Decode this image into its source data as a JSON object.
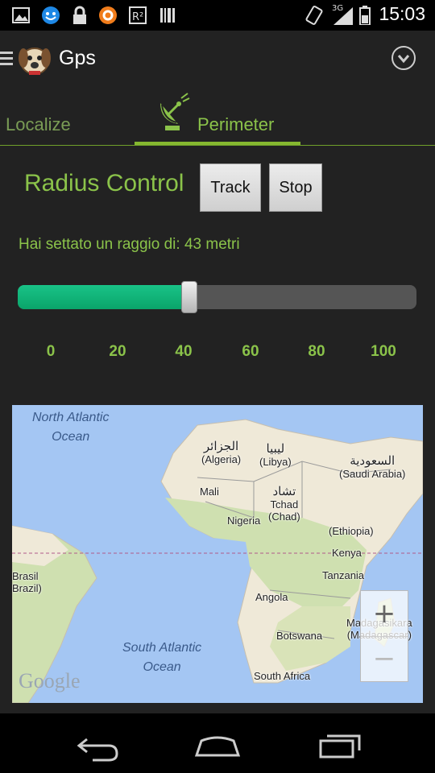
{
  "status_bar": {
    "time": "15:03",
    "network": "3G",
    "left_icons": [
      "image-icon",
      "messenger-icon",
      "lock-icon",
      "avast-icon",
      "r2-icon",
      "barcode-icon"
    ],
    "right_icons": [
      "vibrate-icon",
      "signal-icon",
      "battery-icon"
    ]
  },
  "action_bar": {
    "title": "Gps",
    "icons": [
      "menu-icon",
      "app-logo",
      "overflow-icon"
    ]
  },
  "tabs": [
    {
      "label": "Localize",
      "selected": false
    },
    {
      "label": "Perimeter",
      "selected": true,
      "icon": "satellite-dish-icon"
    }
  ],
  "radius": {
    "title": "Radius Control",
    "track_label": "Track",
    "stop_label": "Stop",
    "info": "Hai settato un raggio di: 43 metri",
    "value": 43,
    "min": 0,
    "max": 100,
    "ticks": [
      "0",
      "20",
      "40",
      "60",
      "80",
      "100"
    ]
  },
  "map": {
    "labels": {
      "north_atlantic": "North Atlantic",
      "north_atlantic_2": "Ocean",
      "algeria_ar": "الجزائر",
      "algeria": "(Algeria)",
      "libya_ar": "ليبيا",
      "libya": "(Libya)",
      "saudi_ar": "السعودية",
      "saudi": "(Saudi Arabia)",
      "mali": "Mali",
      "chad_ar": "تشاد",
      "chad": "Tchad",
      "chad_2": "(Chad)",
      "nigeria": "Nigeria",
      "ethiopia": "(Ethiopia)",
      "kenya": "Kenya",
      "tanzania": "Tanzania",
      "brasil": "Brasil",
      "brasil_2": "Brazil)",
      "angola": "Angola",
      "madagascar": "Madagasikara",
      "madagascar_2": "(Madagascar)",
      "botswana": "Botswana",
      "south_atlantic": "South Atlantic",
      "south_atlantic_2": "Ocean",
      "south_africa": "South Africa"
    },
    "zoom_in": "+",
    "zoom_out": "−",
    "attribution": "Google",
    "colors": {
      "water": "#a4c6f3",
      "land": "#efe9d8",
      "vegetation": "#cfe0b0",
      "equator": "#b15a8a"
    }
  },
  "nav_bar": {
    "icons": [
      "back-icon",
      "home-icon",
      "recent-apps-icon"
    ]
  }
}
